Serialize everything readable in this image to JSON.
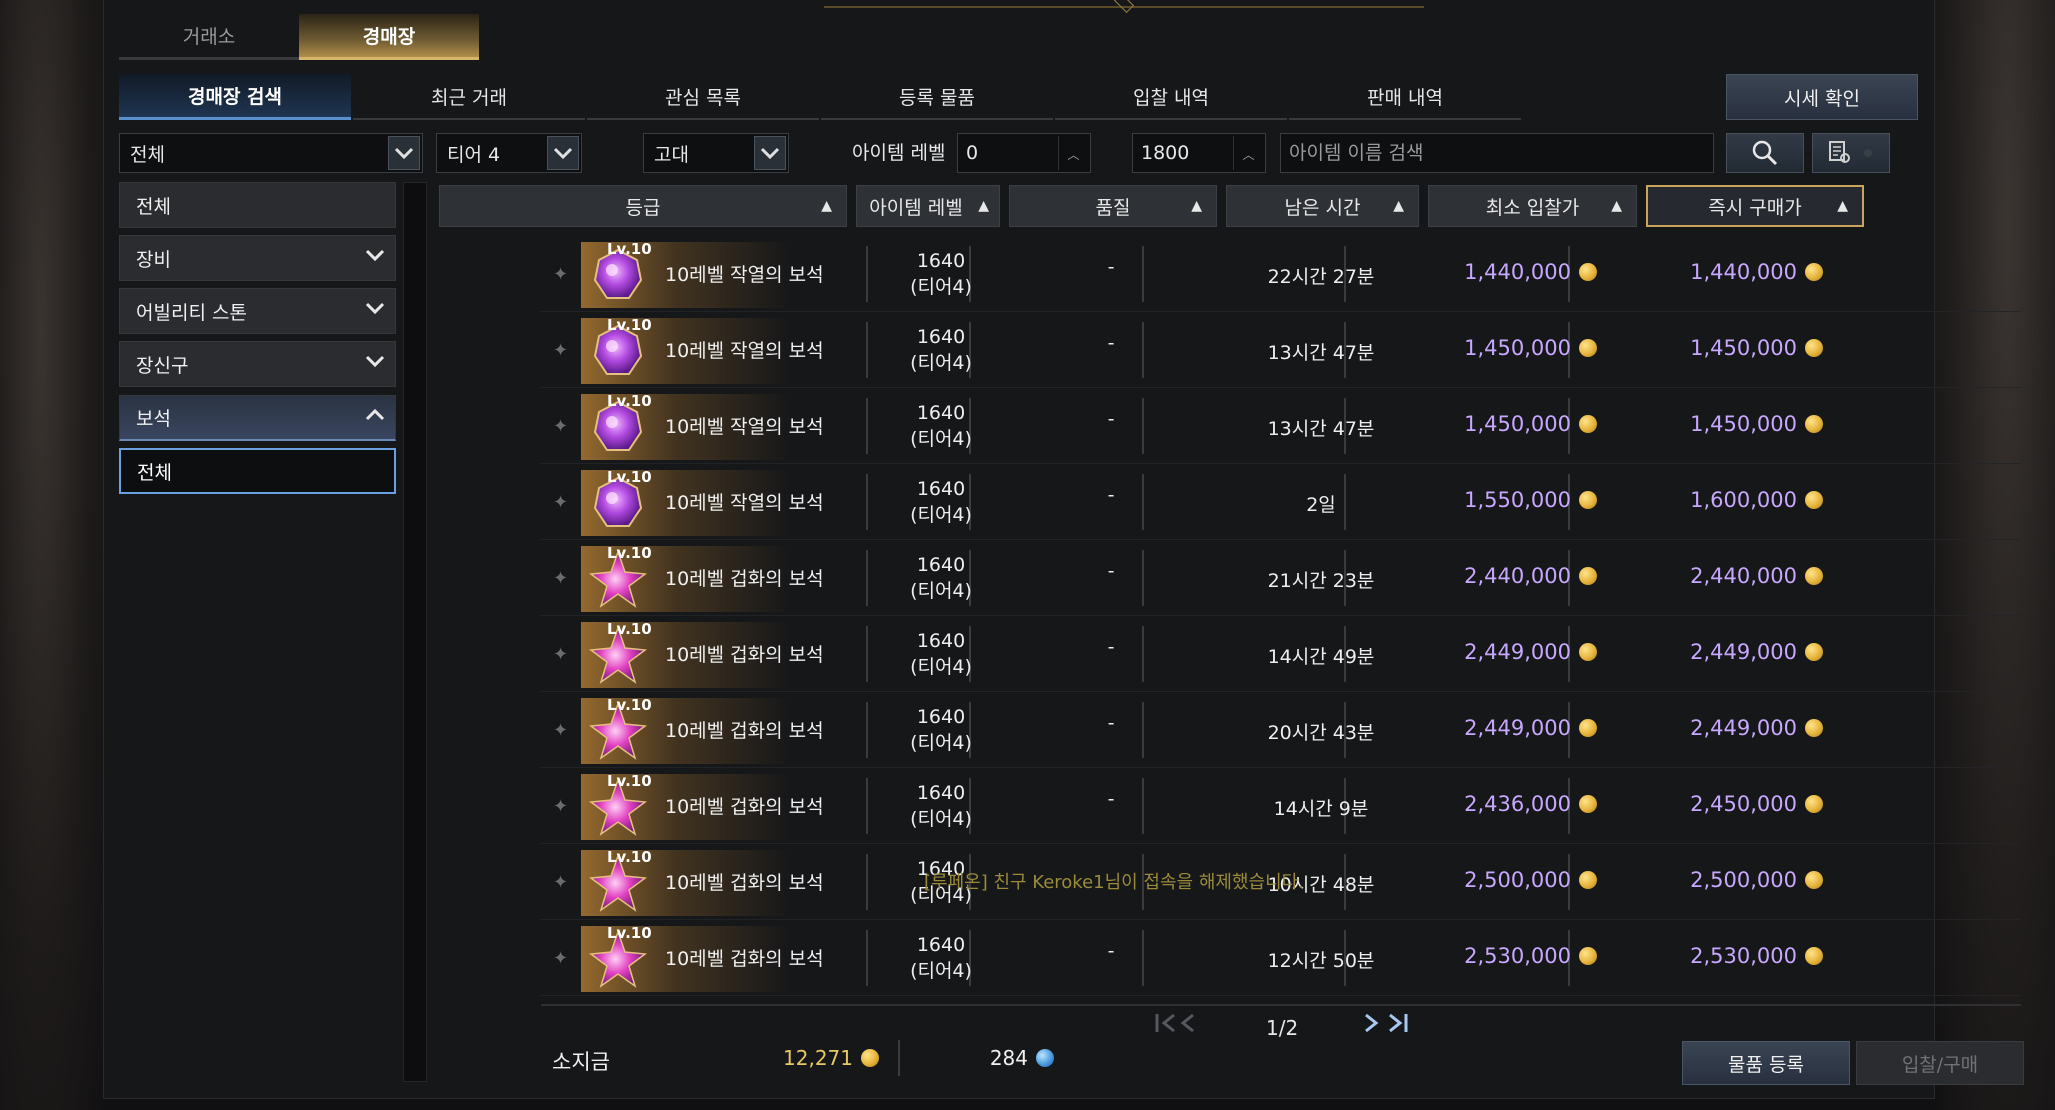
{
  "main_tabs": [
    {
      "label": "거래소",
      "active": false
    },
    {
      "label": "경매장",
      "active": true
    }
  ],
  "sub_tabs": [
    {
      "label": "경매장 검색",
      "active": true
    },
    {
      "label": "최근 거래"
    },
    {
      "label": "관심 목록"
    },
    {
      "label": "등록 물품"
    },
    {
      "label": "입찰 내역"
    },
    {
      "label": "판매 내역"
    }
  ],
  "price_check_label": "시세 확인",
  "filters": {
    "category": "전체",
    "tier": "티어 4",
    "grade": "고대",
    "level_label": "아이템 레벨",
    "level_min": "0",
    "tilde": "~",
    "level_max": "1800",
    "search_placeholder": "아이템 이름 검색"
  },
  "categories": [
    {
      "label": "전체"
    },
    {
      "label": "장비",
      "chevron": "down"
    },
    {
      "label": "어빌리티 스톤",
      "chevron": "down"
    },
    {
      "label": "장신구",
      "chevron": "down"
    },
    {
      "label": "보석",
      "chevron": "up"
    }
  ],
  "subcategory_selected": "전체",
  "columns": [
    "등급",
    "아이템 레벨",
    "품질",
    "남은 시간",
    "최소 입찰가",
    "즉시 구매가"
  ],
  "rows": [
    {
      "lv": "Lv.10",
      "name": "10레벨 작열의 보석",
      "gem": "purple",
      "level": "1640",
      "tier": "(티어4)",
      "quality": "-",
      "time": "22시간 27분",
      "min_bid": "1,440,000",
      "buyout": "1,440,000"
    },
    {
      "lv": "Lv.10",
      "name": "10레벨 작열의 보석",
      "gem": "purple",
      "level": "1640",
      "tier": "(티어4)",
      "quality": "-",
      "time": "13시간 47분",
      "min_bid": "1,450,000",
      "buyout": "1,450,000"
    },
    {
      "lv": "Lv.10",
      "name": "10레벨 작열의 보석",
      "gem": "purple",
      "level": "1640",
      "tier": "(티어4)",
      "quality": "-",
      "time": "13시간 47분",
      "min_bid": "1,450,000",
      "buyout": "1,450,000"
    },
    {
      "lv": "Lv.10",
      "name": "10레벨 작열의 보석",
      "gem": "purple",
      "level": "1640",
      "tier": "(티어4)",
      "quality": "-",
      "time": "2일",
      "min_bid": "1,550,000",
      "buyout": "1,600,000"
    },
    {
      "lv": "Lv.10",
      "name": "10레벨 겁화의 보석",
      "gem": "star",
      "level": "1640",
      "tier": "(티어4)",
      "quality": "-",
      "time": "21시간 23분",
      "min_bid": "2,440,000",
      "buyout": "2,440,000"
    },
    {
      "lv": "Lv.10",
      "name": "10레벨 겁화의 보석",
      "gem": "star",
      "level": "1640",
      "tier": "(티어4)",
      "quality": "-",
      "time": "14시간 49분",
      "min_bid": "2,449,000",
      "buyout": "2,449,000"
    },
    {
      "lv": "Lv.10",
      "name": "10레벨 겁화의 보석",
      "gem": "star",
      "level": "1640",
      "tier": "(티어4)",
      "quality": "-",
      "time": "20시간 43분",
      "min_bid": "2,449,000",
      "buyout": "2,449,000"
    },
    {
      "lv": "Lv.10",
      "name": "10레벨 겁화의 보석",
      "gem": "star",
      "level": "1640",
      "tier": "(티어4)",
      "quality": "-",
      "time": "14시간 9분",
      "min_bid": "2,436,000",
      "buyout": "2,450,000"
    },
    {
      "lv": "Lv.10",
      "name": "10레벨 겁화의 보석",
      "gem": "star",
      "level": "1640",
      "tier": "(티어4)",
      "quality": "",
      "time": "10시간 48분",
      "min_bid": "2,500,000",
      "buyout": "2,500,000"
    },
    {
      "lv": "Lv.10",
      "name": "10레벨 겁화의 보석",
      "gem": "star",
      "level": "1640",
      "tier": "(티어4)",
      "quality": "-",
      "time": "12시간 50분",
      "min_bid": "2,530,000",
      "buyout": "2,530,000"
    }
  ],
  "system_notice": "[루페온] 친구 Keroke1님이 접속을 해제했습니다.",
  "pagination": {
    "current": "1/2"
  },
  "money": {
    "label": "소지금",
    "gold": "12,271",
    "blue_crystal": "284"
  },
  "buttons": {
    "register": "물품 등록",
    "bid_buy": "입찰/구매"
  },
  "colors": {
    "price": "#c8a8ff",
    "gold_text": "#e8c860",
    "active_tab_gold": "#d8b46a",
    "active_subtab_blue": "#5a8fd0"
  }
}
